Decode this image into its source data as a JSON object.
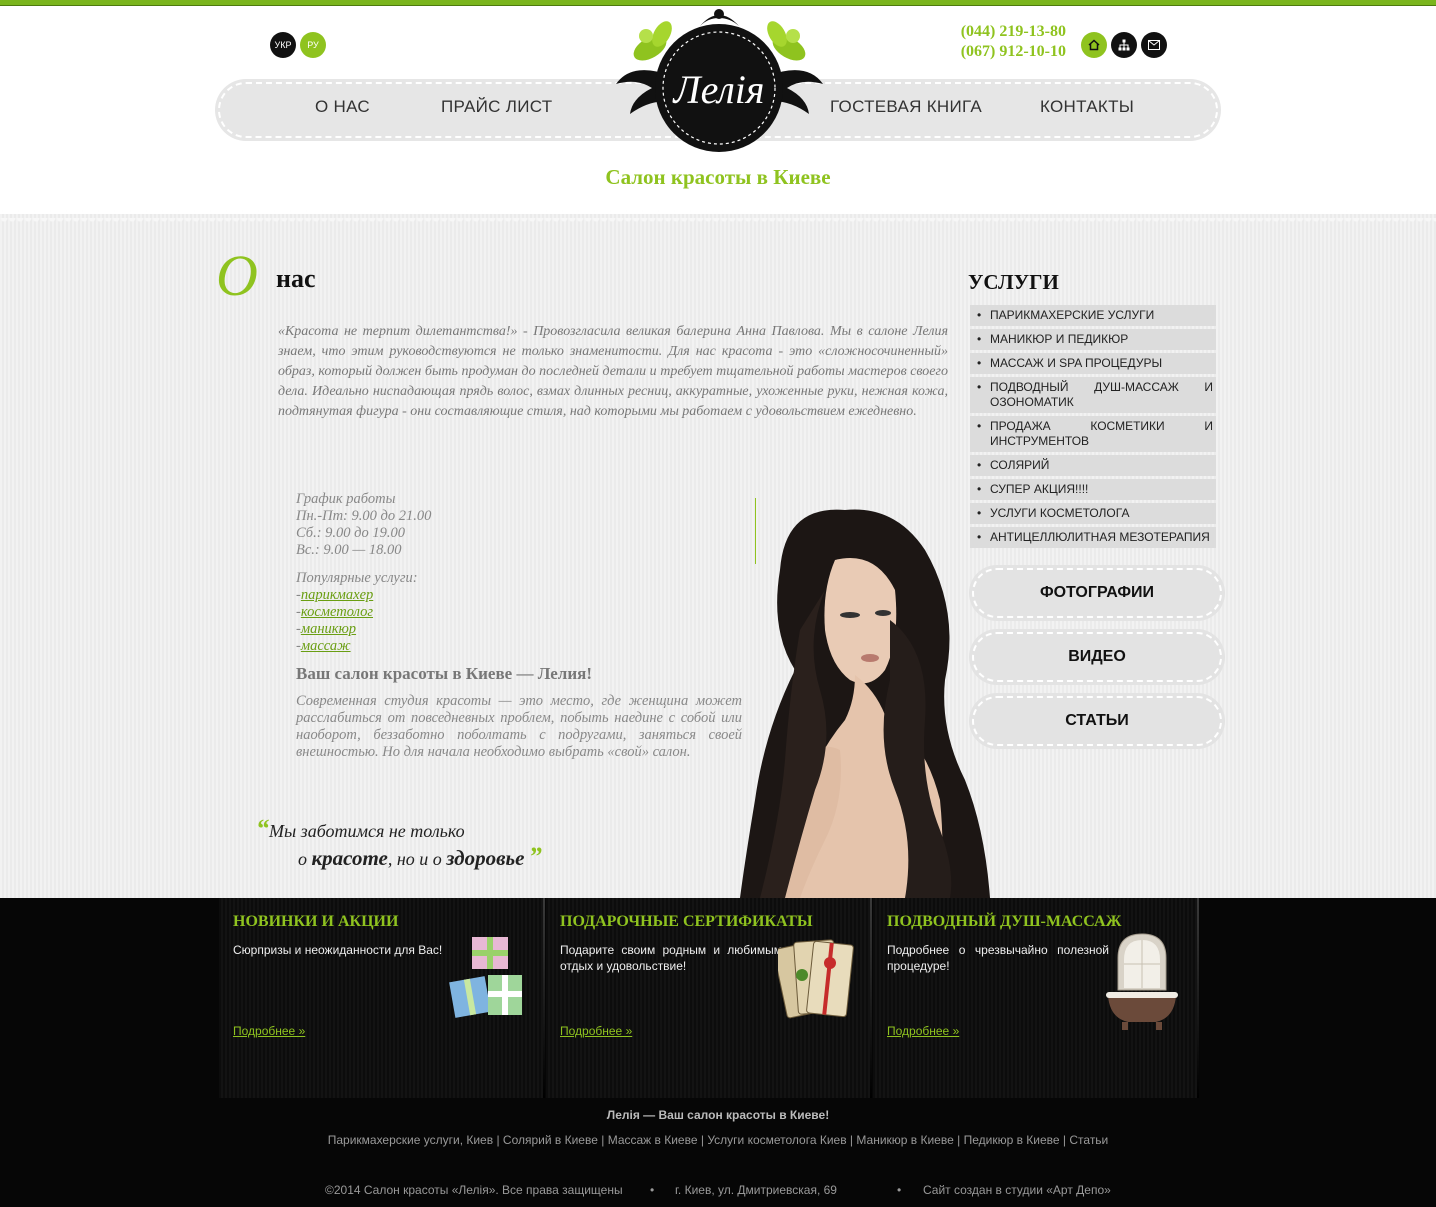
{
  "lang": {
    "ukr": "УКР",
    "ru": "РУ"
  },
  "phones": [
    "(044) 219-13-80",
    "(067) 912-10-10"
  ],
  "header_icons": [
    "home-icon",
    "sitemap-icon",
    "mail-icon"
  ],
  "nav": [
    "О НАС",
    "ПРАЙС ЛИСТ",
    "ГОСТЕВАЯ КНИГА",
    "КОНТАКТЫ"
  ],
  "logo_text": "Лелія",
  "slogan": "Салон красоты в Киеве",
  "about": {
    "big_letter": "О",
    "title": "нас",
    "intro": "«Красота не терпит дилетантства!» - Провозгласила великая балерина Анна Павлова. Мы в салоне Лелия знаем, что этим руководствуются не только знаменитости. Для нас красота - это «сложносочиненный» образ, который должен быть продуман до последней детали и требует тщательной работы мастеров своего дела. Идеально ниспадающая прядь волос, взмах длинных ресниц, аккуратные, ухоженные руки, нежная кожа, подтянутая фигура - они составляющие стиля, над которыми мы работаем с удовольствием ежедневно."
  },
  "schedule": {
    "title": "График работы",
    "lines": [
      "Пн.-Пт: 9.00 до 21.00",
      "Сб.: 9.00 до 19.00",
      "Вс.: 9.00 — 18.00"
    ]
  },
  "popular": {
    "title": "Популярные услуги:",
    "items": [
      "парикмахер",
      "косметолог",
      "маникюр",
      "массаж"
    ]
  },
  "salon": {
    "heading": "Ваш салон красоты в Киеве — Лелия!",
    "text": "Современная студия красоты — это место, где женщина может расслабиться от повседневных проблем, побыть наедине с собой или наоборот, беззаботно поболтать с подругами, заняться своей внешностью. Но для начала необходимо выбрать «свой» салон."
  },
  "quote": {
    "line1": "Мы заботимся не только",
    "pre": "о ",
    "w1": "красоте",
    "mid": ", но и о ",
    "w2": "здоровье"
  },
  "services": {
    "title": "УСЛУГИ",
    "items": [
      "ПАРИКМАХЕРСКИЕ УСЛУГИ",
      "МАНИКЮР И ПЕДИКЮР",
      "МАССАЖ И SPA ПРОЦЕДУРЫ",
      "ПОДВОДНЫЙ ДУШ-МАССАЖ И ОЗОНОМАТИК",
      "ПРОДАЖА КОСМЕТИКИ И ИНСТРУМЕНТОВ",
      "СОЛЯРИЙ",
      "СУПЕР АКЦИЯ!!!!",
      "УСЛУГИ КОСМЕТОЛОГА",
      "АНТИЦЕЛЛЮЛИТНАЯ МЕЗОТЕРАПИЯ"
    ]
  },
  "side_buttons": [
    "ФОТОГРАФИИ",
    "ВИДЕО",
    "СТАТЬИ"
  ],
  "footer_cols": [
    {
      "title": "НОВИНКИ И АКЦИИ",
      "text": "Сюрпризы и неожиданности для Вас!",
      "more": "Подробнее »"
    },
    {
      "title": "ПОДАРОЧНЫЕ СЕРТИФИКАТЫ",
      "text": "Подарите своим родным и любимым отдых и удовольствие!",
      "more": "Подробнее »"
    },
    {
      "title": "ПОДВОДНЫЙ ДУШ-МАССАЖ",
      "text": "Подробнее о чрезвычайно полезной процедуре!",
      "more": "Подробнее »"
    }
  ],
  "footer": {
    "slogan": "Лелія — Ваш салон красоты в Киеве!",
    "links": [
      "Парикмахерские услуги, Киев",
      "Солярий в Киеве",
      "Массаж в Киеве",
      "Услуги косметолога Киев",
      "Маникюр в Киеве",
      "Педикюр в Киеве",
      "Статьи"
    ],
    "copyright": "©2014 Салон красоты «Лелія». Все права защищены",
    "address": "г. Киев, ул. Дмитриевская, 69",
    "studio": "Сайт создан в студии «Арт Депо»"
  },
  "colors": {
    "accent": "#8fc31f",
    "dark": "#060606",
    "menu_bg": "#dcdcdc"
  }
}
